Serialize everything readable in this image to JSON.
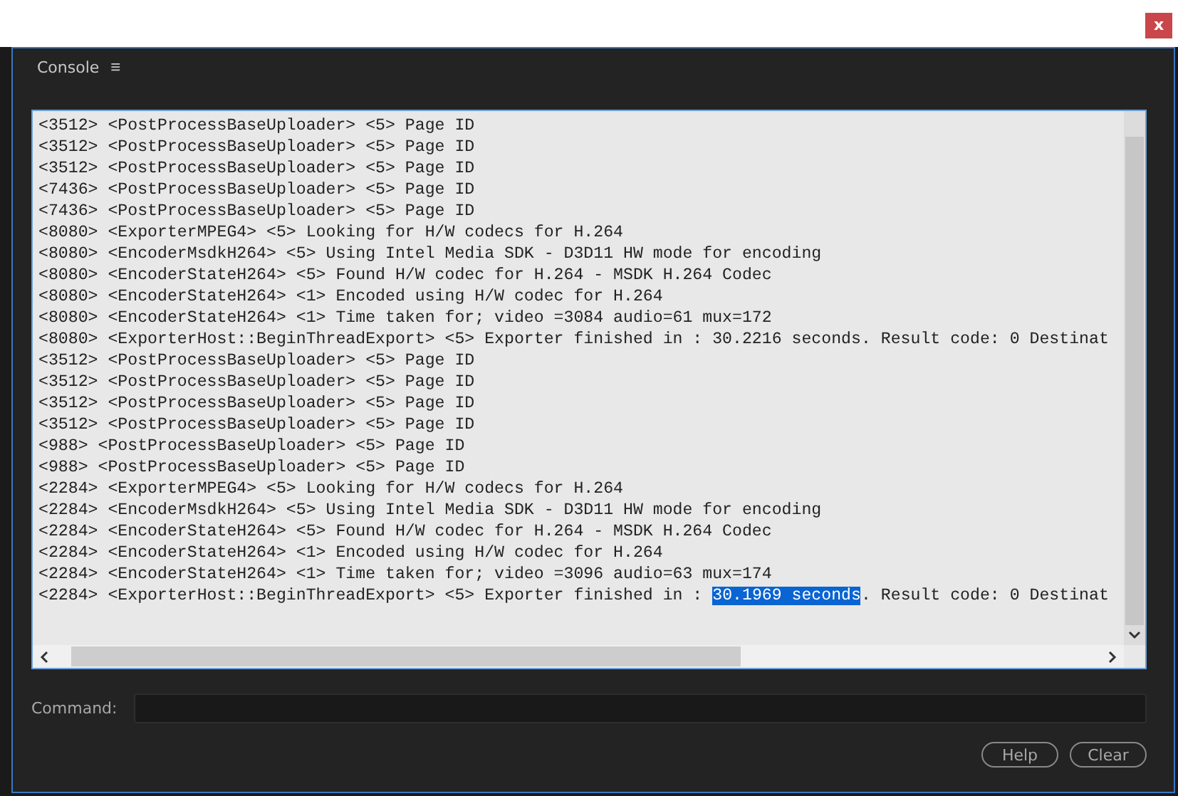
{
  "window": {
    "close": "x"
  },
  "panel": {
    "title": "Console",
    "menu": "≡"
  },
  "log": [
    {
      "text": "<3512> <PostProcessBaseUploader> <5> Page ID"
    },
    {
      "text": "<3512> <PostProcessBaseUploader> <5> Page ID"
    },
    {
      "text": "<3512> <PostProcessBaseUploader> <5> Page ID"
    },
    {
      "text": "<7436> <PostProcessBaseUploader> <5> Page ID"
    },
    {
      "text": "<7436> <PostProcessBaseUploader> <5> Page ID"
    },
    {
      "text": "<8080> <ExporterMPEG4> <5> Looking for H/W codecs for H.264"
    },
    {
      "text": "<8080> <EncoderMsdkH264> <5> Using Intel Media SDK - D3D11 HW mode for encoding"
    },
    {
      "text": "<8080> <EncoderStateH264> <5> Found H/W codec for H.264 - MSDK H.264 Codec"
    },
    {
      "text": "<8080> <EncoderStateH264> <1> Encoded using H/W codec for H.264"
    },
    {
      "text": "<8080> <EncoderStateH264> <1> Time taken for; video =3084 audio=61 mux=172"
    },
    {
      "text": "<8080> <ExporterHost::BeginThreadExport> <5> Exporter finished in : 30.2216 seconds. Result code: 0 Destinat"
    },
    {
      "text": "<3512> <PostProcessBaseUploader> <5> Page ID"
    },
    {
      "text": "<3512> <PostProcessBaseUploader> <5> Page ID"
    },
    {
      "text": "<3512> <PostProcessBaseUploader> <5> Page ID"
    },
    {
      "text": "<3512> <PostProcessBaseUploader> <5> Page ID"
    },
    {
      "text": "<988> <PostProcessBaseUploader> <5> Page ID"
    },
    {
      "text": "<988> <PostProcessBaseUploader> <5> Page ID"
    },
    {
      "text": "<2284> <ExporterMPEG4> <5> Looking for H/W codecs for H.264"
    },
    {
      "text": "<2284> <EncoderMsdkH264> <5> Using Intel Media SDK - D3D11 HW mode for encoding"
    },
    {
      "text": "<2284> <EncoderStateH264> <5> Found H/W codec for H.264 - MSDK H.264 Codec"
    },
    {
      "text": "<2284> <EncoderStateH264> <1> Encoded using H/W codec for H.264"
    },
    {
      "text": "<2284> <EncoderStateH264> <1> Time taken for; video =3096 audio=63 mux=174"
    },
    {
      "text": "<2284> <ExporterHost::BeginThreadExport> <5> Exporter finished in : ",
      "selection": "30.1969 seconds",
      "rest": ". Result code: 0 Destinat"
    }
  ],
  "command": {
    "label": "Command:"
  },
  "buttons": [
    "Help",
    "Clear"
  ]
}
